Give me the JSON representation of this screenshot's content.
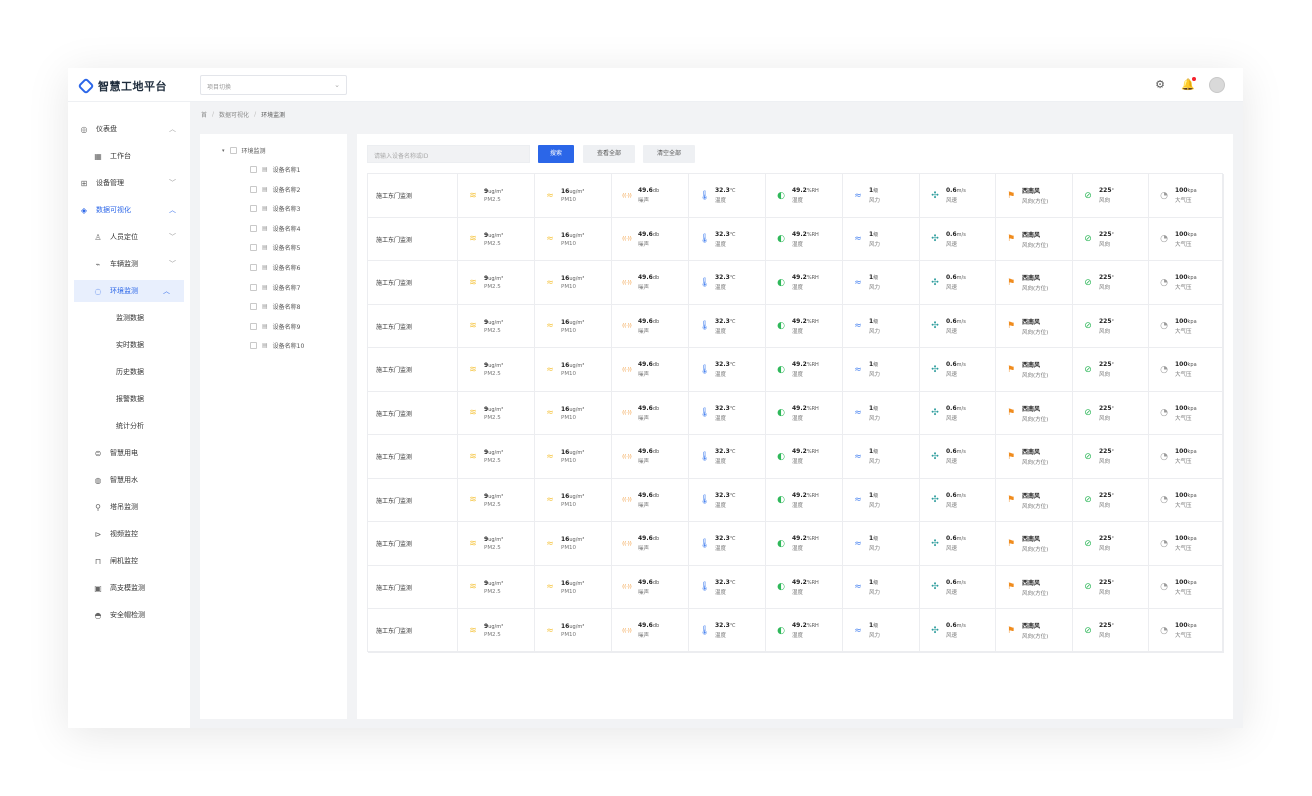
{
  "app": {
    "title": "智慧工地平台",
    "project_placeholder": "项目切换"
  },
  "colors": {
    "accent": "#2b66e8",
    "dust": "#f5c542",
    "noise": "#f08c1e",
    "temp": "#4d86f0",
    "humid": "#2fb85a",
    "wind": "#2f9e9e",
    "dir": "#f08c1e",
    "angle": "#2fb85a",
    "pressure": "#9b9b9b"
  },
  "header_icons": [
    "settings-icon",
    "bell-icon",
    "avatar"
  ],
  "sidebar": {
    "items": [
      {
        "label": "仪表盘",
        "icon": "dashboard-icon",
        "arrow": "︿",
        "state": "normal"
      },
      {
        "label": "工作台",
        "icon": "grid-icon",
        "arrow": "",
        "state": "child"
      },
      {
        "label": "设备管理",
        "icon": "device-icon",
        "arrow": "﹀",
        "state": "normal"
      },
      {
        "label": "数据可视化",
        "icon": "chart-icon",
        "arrow": "︿",
        "state": "active"
      },
      {
        "label": "人员定位",
        "icon": "person-icon",
        "arrow": "﹀",
        "state": "child"
      },
      {
        "label": "车辆监测",
        "icon": "car-icon",
        "arrow": "﹀",
        "state": "child"
      },
      {
        "label": "环境监测",
        "icon": "env-icon",
        "arrow": "︿",
        "state": "selected"
      },
      {
        "label": "监测数据",
        "icon": "",
        "arrow": "",
        "state": "grandchild"
      },
      {
        "label": "实时数据",
        "icon": "",
        "arrow": "",
        "state": "grandchild"
      },
      {
        "label": "历史数据",
        "icon": "",
        "arrow": "",
        "state": "grandchild"
      },
      {
        "label": "报警数据",
        "icon": "",
        "arrow": "",
        "state": "grandchild"
      },
      {
        "label": "统计分析",
        "icon": "",
        "arrow": "",
        "state": "grandchild"
      },
      {
        "label": "智慧用电",
        "icon": "power-icon",
        "arrow": "",
        "state": "child"
      },
      {
        "label": "智慧用水",
        "icon": "water-icon",
        "arrow": "",
        "state": "child"
      },
      {
        "label": "塔吊监测",
        "icon": "crane-icon",
        "arrow": "",
        "state": "child"
      },
      {
        "label": "视频监控",
        "icon": "camera-icon",
        "arrow": "",
        "state": "child"
      },
      {
        "label": "闸机监控",
        "icon": "gate-icon",
        "arrow": "",
        "state": "child"
      },
      {
        "label": "高支模监测",
        "icon": "frame-icon",
        "arrow": "",
        "state": "child"
      },
      {
        "label": "安全帽检测",
        "icon": "helmet-icon",
        "arrow": "",
        "state": "child"
      }
    ]
  },
  "breadcrumb": [
    "首",
    "数据可视化",
    "环境监测"
  ],
  "tree": {
    "root": "环境监测",
    "devices": [
      "设备名称1",
      "设备名称2",
      "设备名称3",
      "设备名称4",
      "设备名称5",
      "设备名称6",
      "设备名称7",
      "设备名称8",
      "设备名称9",
      "设备名称10"
    ]
  },
  "toolbar": {
    "search_placeholder": "请输入设备名称或ID",
    "search_label": "搜索",
    "view_all_label": "查看全部",
    "clear_all_label": "清空全部"
  },
  "table": {
    "rows": [
      {
        "name": "施工东门监测"
      },
      {
        "name": "施工东门监测"
      },
      {
        "name": "施工东门监测"
      },
      {
        "name": "施工东门监测"
      },
      {
        "name": "施工东门监测"
      },
      {
        "name": "施工东门监测"
      },
      {
        "name": "施工东门监测"
      },
      {
        "name": "施工东门监测"
      },
      {
        "name": "施工东门监测"
      },
      {
        "name": "施工东门监测"
      },
      {
        "name": "施工东门监测"
      }
    ],
    "metrics": [
      {
        "value": "9",
        "unit": "ug/m³",
        "label": "PM2.5",
        "icon": "pm25-icon",
        "glyph": "≋",
        "color": "#f5c542"
      },
      {
        "value": "16",
        "unit": "ug/m³",
        "label": "PM10",
        "icon": "pm10-icon",
        "glyph": "≈",
        "color": "#f5c542"
      },
      {
        "value": "49.6",
        "unit": "db",
        "label": "噪声",
        "icon": "noise-icon",
        "glyph": "((·))",
        "color": "#f08c1e"
      },
      {
        "value": "32.3",
        "unit": "℃",
        "label": "温度",
        "icon": "thermometer-icon",
        "glyph": "🌡",
        "color": "#4d86f0"
      },
      {
        "value": "49.2",
        "unit": "%RH",
        "label": "湿度",
        "icon": "humidity-icon",
        "glyph": "◐",
        "color": "#2fb85a"
      },
      {
        "value": "1",
        "unit": "级",
        "label": "风力",
        "icon": "wind-power-icon",
        "glyph": "≈",
        "color": "#4d86f0"
      },
      {
        "value": "0.6",
        "unit": "m/s",
        "label": "风速",
        "icon": "wind-speed-icon",
        "glyph": "✣",
        "color": "#2f9e9e"
      },
      {
        "value": "西南风",
        "unit": "",
        "label": "风向(方位)",
        "icon": "wind-direction-icon",
        "glyph": "⚑",
        "color": "#f08c1e"
      },
      {
        "value": "225",
        "unit": "°",
        "label": "风向",
        "icon": "compass-icon",
        "glyph": "⊘",
        "color": "#2fb85a"
      },
      {
        "value": "100",
        "unit": "kpa",
        "label": "大气压",
        "icon": "pressure-icon",
        "glyph": "◔",
        "color": "#9b9b9b"
      }
    ]
  }
}
